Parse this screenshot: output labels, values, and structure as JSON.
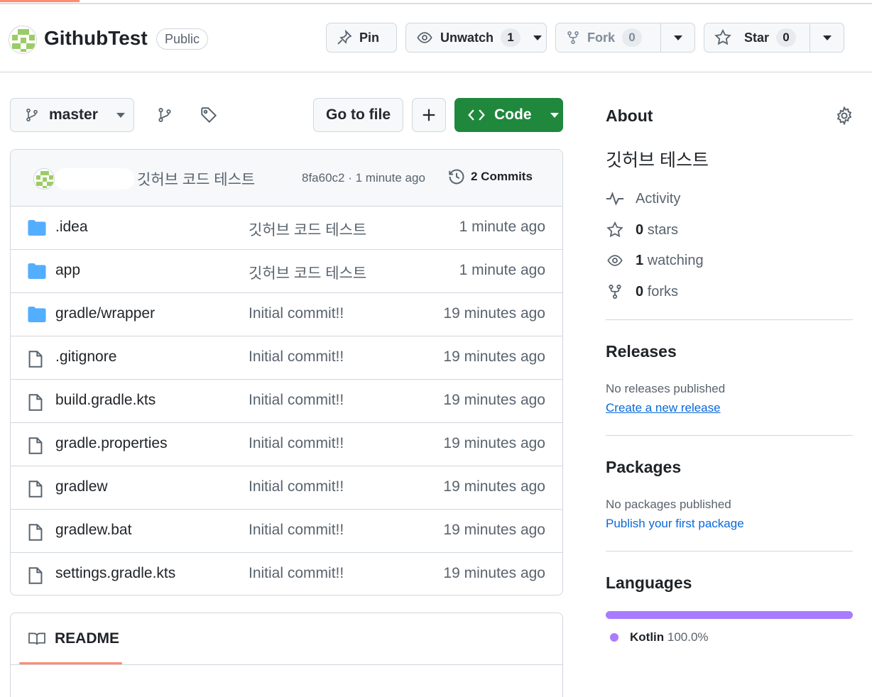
{
  "header": {
    "repo_name": "GithubTest",
    "visibility": "Public",
    "pin_label": "Pin",
    "watch_label": "Unwatch",
    "watch_count": "1",
    "fork_label": "Fork",
    "fork_count": "0",
    "star_label": "Star",
    "star_count": "0"
  },
  "toolbar": {
    "branch": "master",
    "go_to_file": "Go to file",
    "code_label": "Code"
  },
  "commit": {
    "message": "깃허브 코드 테스트",
    "meta": "8fa60c2 · 1 minute ago",
    "commits_label": "2 Commits"
  },
  "files": [
    {
      "type": "dir",
      "name": ".idea",
      "message": "깃허브 코드 테스트",
      "time": "1 minute ago"
    },
    {
      "type": "dir",
      "name": "app",
      "message": "깃허브 코드 테스트",
      "time": "1 minute ago"
    },
    {
      "type": "dir",
      "name": "gradle/wrapper",
      "message": "Initial commit!!",
      "time": "19 minutes ago"
    },
    {
      "type": "file",
      "name": ".gitignore",
      "message": "Initial commit!!",
      "time": "19 minutes ago"
    },
    {
      "type": "file",
      "name": "build.gradle.kts",
      "message": "Initial commit!!",
      "time": "19 minutes ago"
    },
    {
      "type": "file",
      "name": "gradle.properties",
      "message": "Initial commit!!",
      "time": "19 minutes ago"
    },
    {
      "type": "file",
      "name": "gradlew",
      "message": "Initial commit!!",
      "time": "19 minutes ago"
    },
    {
      "type": "file",
      "name": "gradlew.bat",
      "message": "Initial commit!!",
      "time": "19 minutes ago"
    },
    {
      "type": "file",
      "name": "settings.gradle.kts",
      "message": "Initial commit!!",
      "time": "19 minutes ago"
    }
  ],
  "readme": {
    "tab_label": "README"
  },
  "about": {
    "title": "About",
    "description": "깃허브 테스트",
    "activity_label": "Activity",
    "stars_count": "0",
    "stars_label": "stars",
    "watching_count": "1",
    "watching_label": "watching",
    "forks_count": "0",
    "forks_label": "forks"
  },
  "releases": {
    "title": "Releases",
    "note": "No releases published",
    "link": "Create a new release"
  },
  "packages": {
    "title": "Packages",
    "note": "No packages published",
    "link": "Publish your first package"
  },
  "languages": {
    "title": "Languages",
    "items": [
      {
        "name": "Kotlin",
        "percent": "100.0%",
        "color": "#a97bff",
        "share": 1.0
      }
    ]
  },
  "colors": {
    "accent_green": "#1f883d",
    "link_blue": "#0969da",
    "folder_blue": "#54aeff",
    "tab_underline": "#fd8c73"
  },
  "icons": {
    "pin": "pin-icon",
    "eye": "eye-icon",
    "fork": "repo-forked-icon",
    "star": "star-icon",
    "branch": "git-branch-icon",
    "tag": "tag-icon",
    "plus": "plus-icon",
    "code": "code-icon",
    "history": "history-icon",
    "folder": "file-directory-icon",
    "file": "file-icon",
    "book": "book-icon",
    "gear": "gear-icon",
    "pulse": "pulse-icon"
  }
}
